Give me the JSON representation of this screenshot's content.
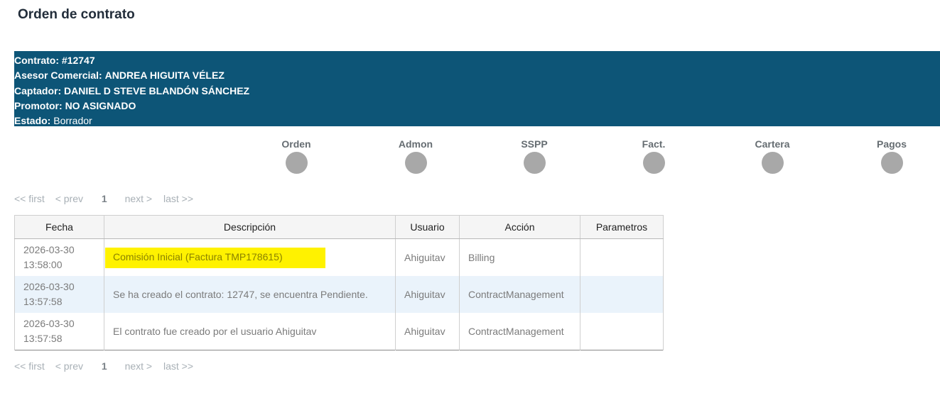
{
  "page": {
    "title": "Orden de contrato"
  },
  "contract_info": {
    "contract_label": "Contrato:",
    "contract_value": "#12747",
    "advisor_label": "Asesor Comercial:",
    "advisor_value": "ANDREA HIGUITA VÉLEZ",
    "captor_label": "Captador:",
    "captor_value": "DANIEL D STEVE BLANDÓN SÁNCHEZ",
    "promoter_label": "Promotor:",
    "promoter_value": "NO ASIGNADO",
    "status_label": "Estado:",
    "status_value": "Borrador"
  },
  "steps": [
    "Orden",
    "Admon",
    "SSPP",
    "Fact.",
    "Cartera",
    "Pagos"
  ],
  "pagination": {
    "first": "<< first",
    "prev": "< prev",
    "current": "1",
    "next": "next >",
    "last": "last >>"
  },
  "table": {
    "headers": [
      "Fecha",
      "Descripción",
      "Usuario",
      "Acción",
      "Parametros"
    ],
    "rows": [
      {
        "date": "2026-03-30",
        "time": "13:58:00",
        "description": "Comisión Inicial (Factura TMP178615)",
        "user": "Ahiguitav",
        "action": "Billing",
        "params": ""
      },
      {
        "date": "2026-03-30",
        "time": "13:57:58",
        "description": "Se ha creado el contrato: 12747, se encuentra Pendiente.",
        "user": "Ahiguitav",
        "action": "ContractManagement",
        "params": ""
      },
      {
        "date": "2026-03-30",
        "time": "13:57:58",
        "description": "El contrato fue creado por el usuario Ahiguitav",
        "user": "Ahiguitav",
        "action": "ContractManagement",
        "params": ""
      }
    ]
  },
  "colors": {
    "header_bar": "#0d5577",
    "highlight": "#fff200",
    "step_dot": "#a8a8a8",
    "alt_row": "#eaf3fb"
  }
}
